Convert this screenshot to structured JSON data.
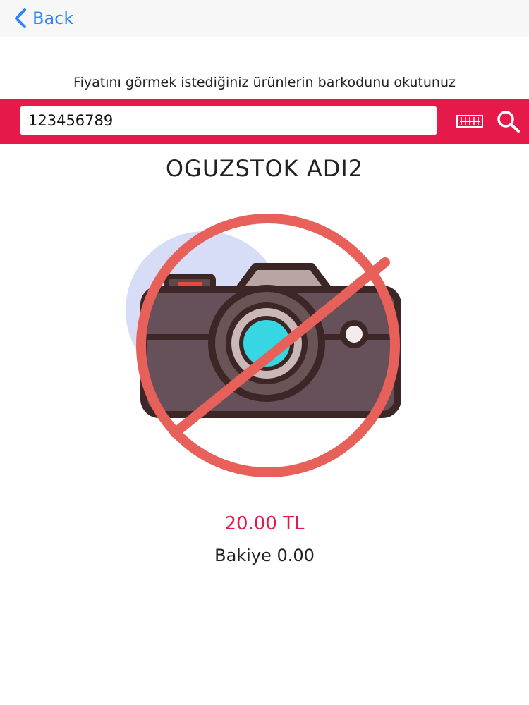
{
  "navbar": {
    "back_label": "Back",
    "back_icon": "chevron-left-icon",
    "accent_color": "#2f86f6"
  },
  "instruction": "Fiyatını görmek istediğiniz ürünlerin barkodunu okutunuz",
  "search": {
    "value": "123456789",
    "bar_color": "#e5194a",
    "barcode_icon": "barcode-icon",
    "search_icon": "search-icon"
  },
  "product": {
    "name": "OGUZSTOK  ADI2",
    "image_icon": "no-camera-icon",
    "price": "20.00 TL",
    "price_color": "#e5194a",
    "balance": "Bakiye 0.00"
  }
}
